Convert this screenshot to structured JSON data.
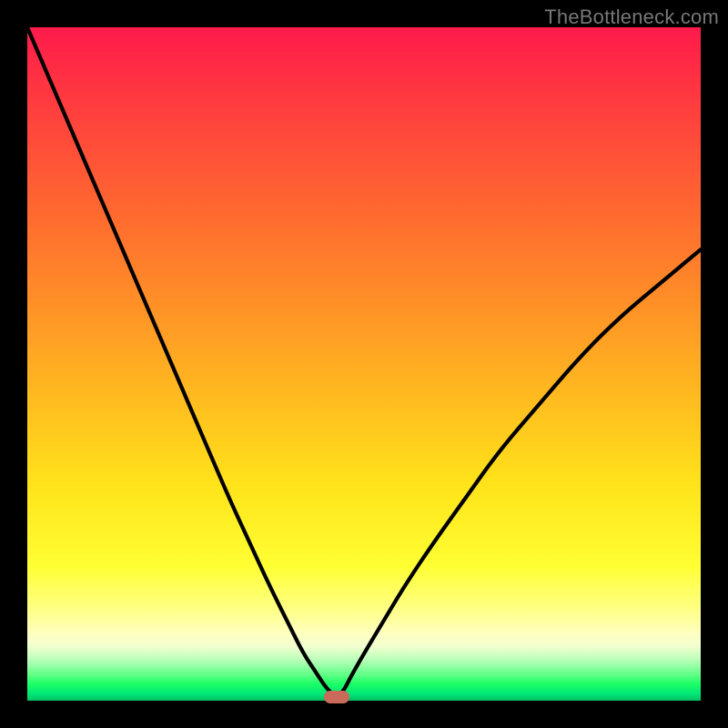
{
  "watermark": "TheBottleneck.com",
  "chart_data": {
    "type": "line",
    "title": "",
    "xlabel": "",
    "ylabel": "",
    "xlim": [
      0,
      100
    ],
    "ylim": [
      0,
      100
    ],
    "background_gradient": {
      "top": "#ff1a4b",
      "middle": "#ffe31a",
      "bottom": "#00c060"
    },
    "series": [
      {
        "name": "bottleneck-curve",
        "x": [
          0,
          3,
          6,
          9,
          12,
          15,
          18,
          21,
          24,
          27,
          30,
          33,
          36,
          39,
          41,
          43,
          44.5,
          46,
          47,
          48,
          50,
          53,
          56,
          60,
          65,
          70,
          76,
          82,
          88,
          94,
          100
        ],
        "y": [
          100,
          93,
          86,
          79,
          72,
          65,
          58,
          51,
          44,
          37,
          30,
          23.5,
          17,
          11,
          7,
          4,
          1.7,
          0.5,
          1.5,
          3.5,
          7,
          12,
          17,
          23,
          30,
          37,
          44,
          51,
          57,
          62,
          67
        ]
      }
    ],
    "marker": {
      "x": 46,
      "y": 0.5,
      "color": "#c96a5a"
    }
  }
}
